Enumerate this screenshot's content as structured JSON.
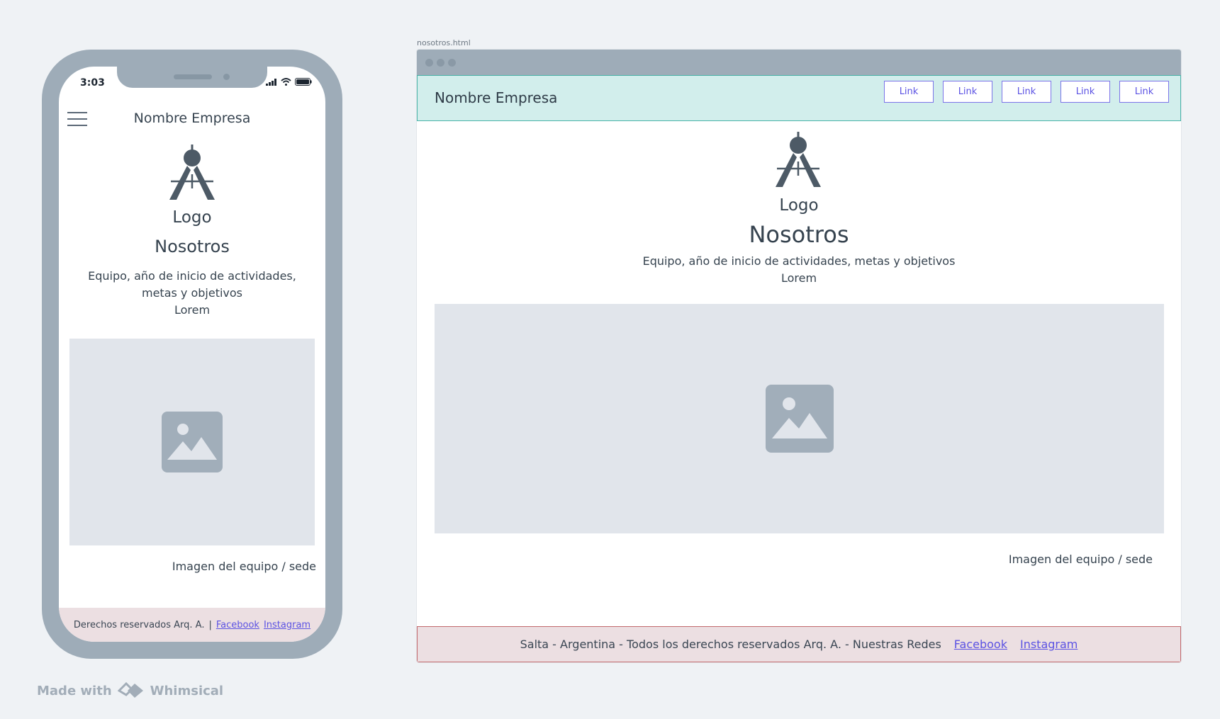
{
  "phone": {
    "status_time": "3:03",
    "brand": "Nombre Empresa",
    "logo_label": "Logo",
    "title": "Nosotros",
    "description_line1": "Equipo, año de inicio de actividades,",
    "description_line2": "metas y objetivos",
    "description_line3": "Lorem",
    "image_caption": "Imagen del equipo / sede",
    "footer": {
      "text": "Derechos reservados Arq. A.",
      "separator": "|",
      "facebook": "Facebook",
      "instagram": "Instagram"
    }
  },
  "browser": {
    "file_name": "nosotros.html",
    "brand": "Nombre Empresa",
    "nav_links": [
      "Link",
      "Link",
      "Link",
      "Link",
      "Link"
    ],
    "logo_label": "Logo",
    "title": "Nosotros",
    "description_line1": "Equipo, año de inicio de actividades, metas y objetivos",
    "description_line2": "Lorem",
    "image_caption": "Imagen del equipo / sede",
    "footer": {
      "text": "Salta - Argentina - Todos los derechos reservados Arq. A.  - Nuestras Redes",
      "facebook": "Facebook",
      "instagram": "Instagram"
    }
  },
  "watermark": {
    "made_with": "Made with",
    "brand": "Whimsical"
  },
  "colors": {
    "accent_link": "#5b52e3",
    "navbar_bg": "#d2eeec",
    "footer_bg": "#ecdfe2",
    "device_frame": "#9eacb8"
  }
}
